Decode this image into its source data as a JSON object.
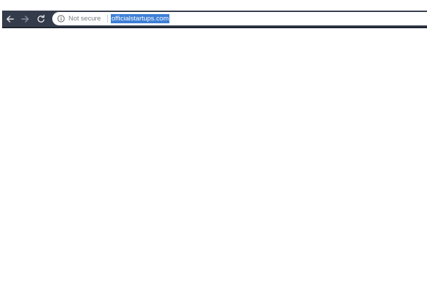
{
  "browser": {
    "security_text": "Not secure",
    "url": "officialstartups.com",
    "icons": {
      "back": "arrow-left-icon",
      "forward": "arrow-right-icon",
      "reload": "reload-icon",
      "info": "info-circle-icon"
    },
    "colors": {
      "toolbar": "#343b4a",
      "url_highlight": "#3d7fd6",
      "security_text": "#7b7f86"
    }
  }
}
